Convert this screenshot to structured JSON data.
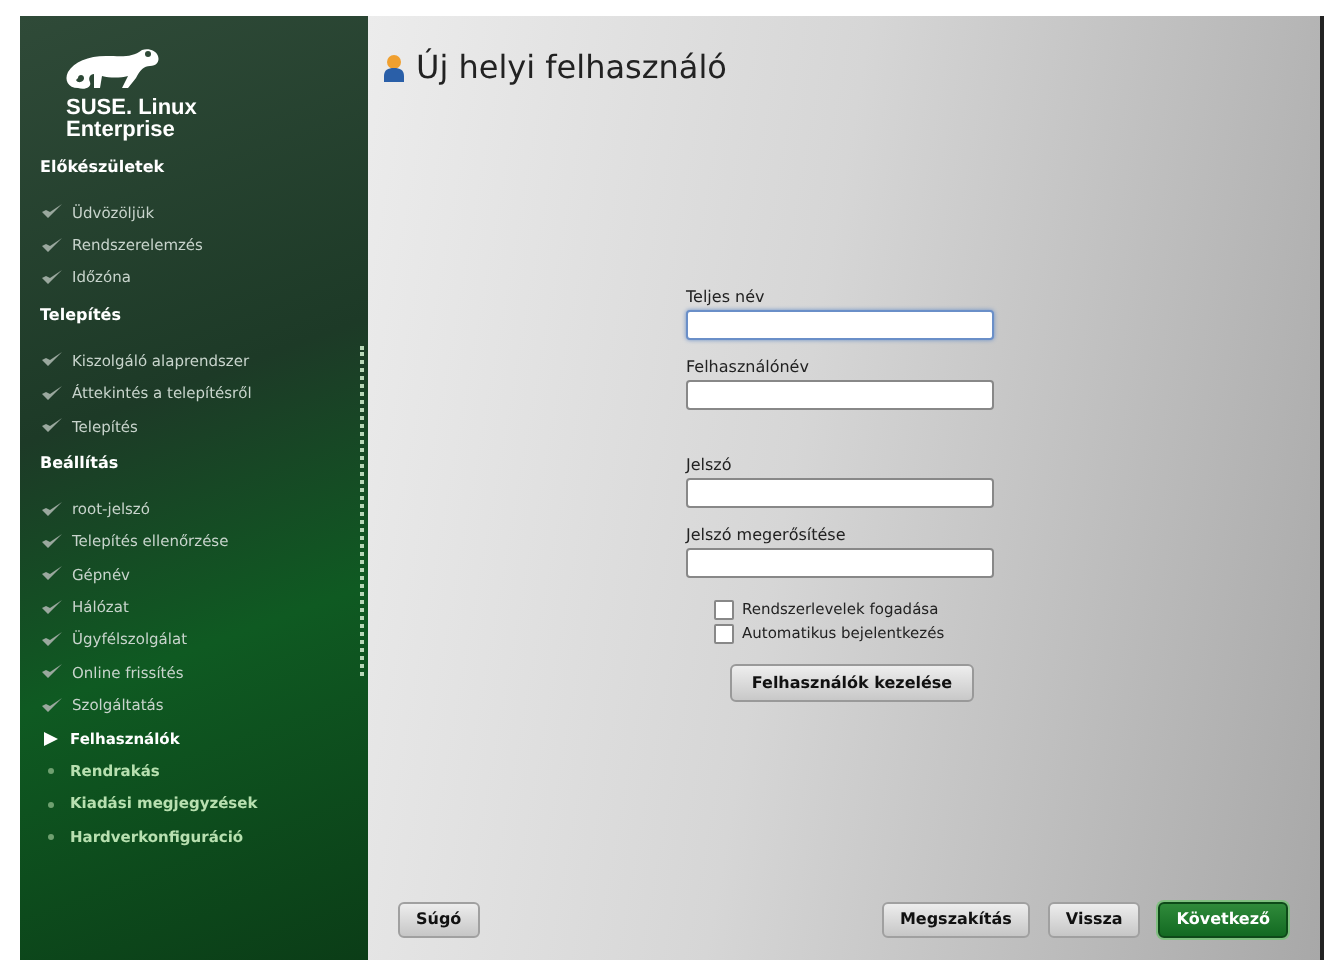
{
  "sidebar": {
    "brand": "SUSE. Linux Enterprise",
    "sections": [
      {
        "title": "Előkészületek",
        "steps": [
          {
            "label": "Üdvözöljük",
            "done": true,
            "current": false
          },
          {
            "label": "Rendszerelemzés",
            "done": true,
            "current": false
          },
          {
            "label": "Időzóna",
            "done": true,
            "current": false
          }
        ]
      },
      {
        "title": "Telepítés",
        "steps": [
          {
            "label": "Kiszolgáló alaprendszer",
            "done": true,
            "current": false
          },
          {
            "label": "Áttekintés a telepítésről",
            "done": true,
            "current": false
          },
          {
            "label": "Telepítés",
            "done": true,
            "current": false
          }
        ]
      },
      {
        "title": "Beállítás",
        "steps": [
          {
            "label": "root-jelszó",
            "done": true,
            "current": false
          },
          {
            "label": "Telepítés ellenőrzése",
            "done": true,
            "current": false
          },
          {
            "label": "Gépnév",
            "done": true,
            "current": false
          },
          {
            "label": "Hálózat",
            "done": true,
            "current": false
          },
          {
            "label": "Ügyfélszolgálat",
            "done": true,
            "current": false
          },
          {
            "label": "Online frissítés",
            "done": true,
            "current": false
          },
          {
            "label": "Szolgáltatás",
            "done": true,
            "current": false
          },
          {
            "label": "Felhasználók",
            "done": false,
            "current": true
          },
          {
            "label": "Rendrakás",
            "done": false,
            "current": false
          },
          {
            "label": "Kiadási megjegyzések",
            "done": false,
            "current": false
          },
          {
            "label": "Hardverkonfiguráció",
            "done": false,
            "current": false
          }
        ]
      }
    ]
  },
  "title": "Új helyi felhasználó",
  "fields": [
    {
      "label": "Teljes név",
      "focused": true
    },
    {
      "label": "Felhasználónév",
      "focused": false
    },
    {
      "label": "Jelszó",
      "focused": false
    },
    {
      "label": "Jelszó megerősítése",
      "focused": false
    }
  ],
  "checkboxes": [
    {
      "label": "Rendszerlevelek fogadása",
      "checked": false
    },
    {
      "label": "Automatikus bejelentkezés",
      "checked": false
    }
  ],
  "manage_button": "Felhasználók kezelése",
  "buttons": [
    {
      "label": "Súgó",
      "primary": false
    },
    {
      "label": "Megszakítás",
      "primary": false
    },
    {
      "label": "Vissza",
      "primary": false
    },
    {
      "label": "Következő",
      "primary": true
    }
  ]
}
